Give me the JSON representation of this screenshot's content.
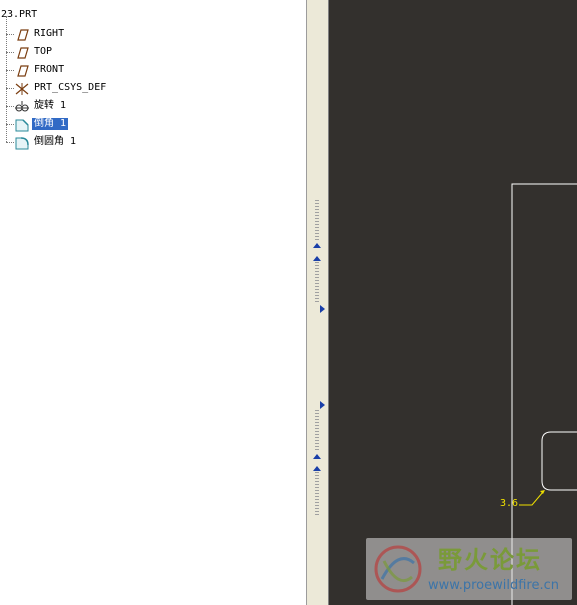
{
  "model_tree": {
    "root": "23.PRT",
    "items": [
      {
        "label": "RIGHT",
        "icon": "datum-plane-icon"
      },
      {
        "label": "TOP",
        "icon": "datum-plane-icon"
      },
      {
        "label": "FRONT",
        "icon": "datum-plane-icon"
      },
      {
        "label": "PRT_CSYS_DEF",
        "icon": "coordinate-system-icon"
      },
      {
        "label": "旋转 1",
        "icon": "revolve-icon"
      },
      {
        "label": "倒角 1",
        "icon": "chamfer-icon",
        "selected": true
      },
      {
        "label": "倒圆角 1",
        "icon": "round-icon"
      }
    ]
  },
  "viewport": {
    "background": "#33302d",
    "dimension_label": "3.6"
  },
  "watermark": {
    "title": "野火论坛",
    "url": "www.proewildfire.cn"
  },
  "colors": {
    "selection": "#316ac5",
    "dimension": "#f0e000",
    "geometry": "#ffffff",
    "sash_arrow": "#1a3fa8"
  }
}
